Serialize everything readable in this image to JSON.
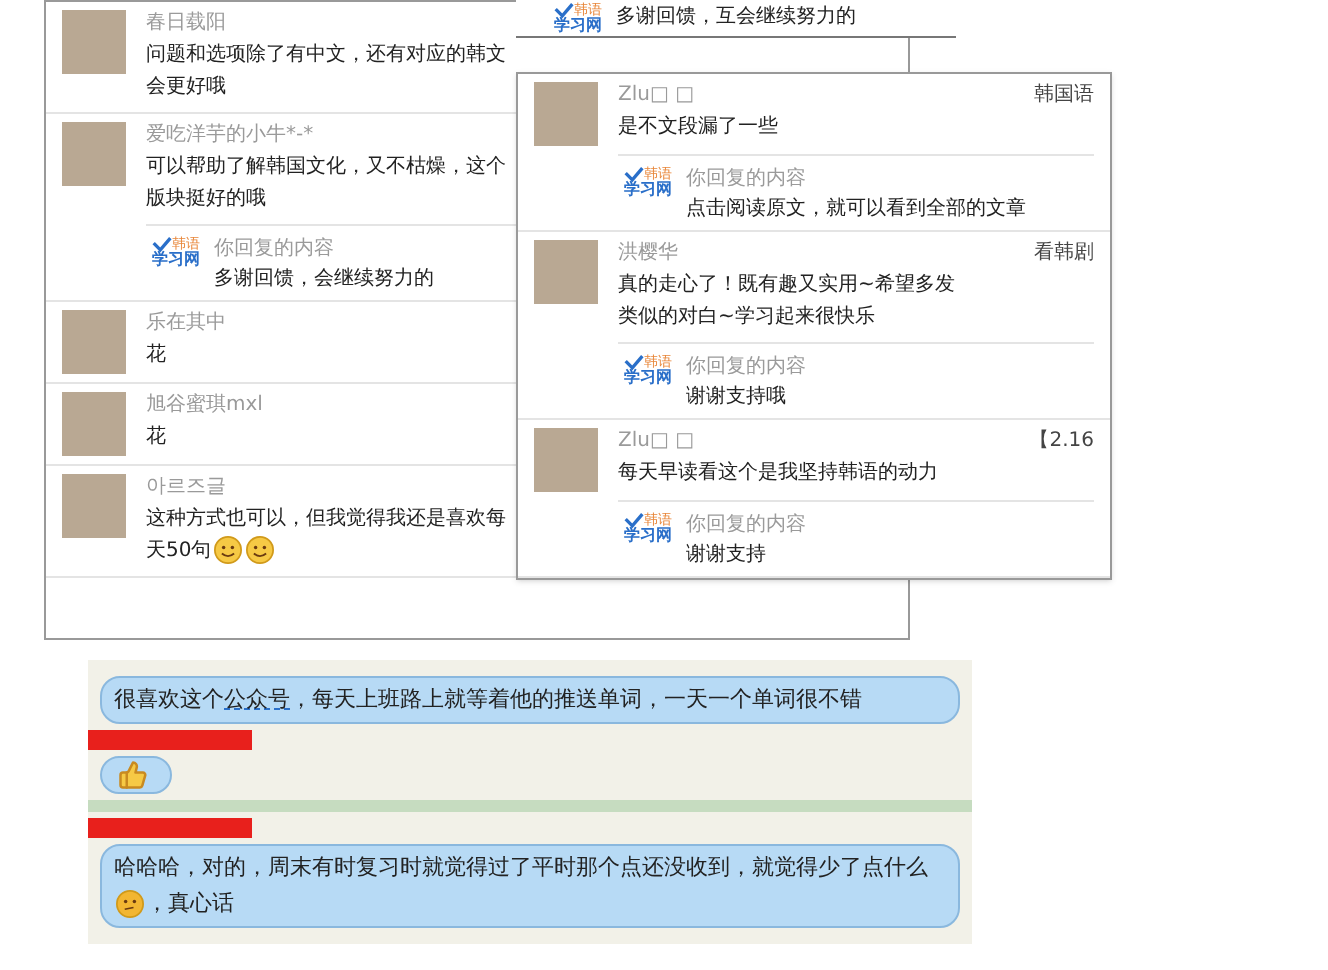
{
  "back_fragment": {
    "logo_top": "韩语",
    "logo_bottom": "学习网",
    "text": "多谢回馈，互会继续努力的"
  },
  "left_panel": {
    "comments": [
      {
        "author": "春日载阳",
        "text": "问题和选项除了有中文，还有对应的韩文会更好哦"
      },
      {
        "author": "爱吃洋芋的小牛*-*",
        "text": "可以帮助了解韩国文化，又不枯燥，这个版块挺好的哦",
        "reply": {
          "logo_top": "韩语",
          "logo_bottom": "学习网",
          "label": "你回复的内容",
          "text": "多谢回馈，会继续努力的"
        }
      },
      {
        "author": "乐在其中",
        "text": "花"
      },
      {
        "author": "旭谷蜜琪mxl",
        "text": "花"
      },
      {
        "author": "아르즈글",
        "text": "这种方式也可以，但我觉得我还是喜欢每天50句",
        "emojis": [
          {
            "kind": "smile"
          },
          {
            "kind": "smile"
          }
        ]
      }
    ]
  },
  "right_panel": {
    "comments": [
      {
        "author": "Zlu□ □",
        "tag": "韩国语",
        "text": "是不文段漏了一些",
        "reply": {
          "logo_top": "韩语",
          "logo_bottom": "学习网",
          "label": "你回复的内容",
          "text": "点击阅读原文，就可以看到全部的文章"
        }
      },
      {
        "author": "洪樱华",
        "tag": "看韩剧",
        "text": "真的走心了！既有趣又实用~希望多发类似的对白~学习起来很快乐",
        "reply": {
          "logo_top": "韩语",
          "logo_bottom": "学习网",
          "label": "你回复的内容",
          "text": "谢谢支持哦"
        }
      },
      {
        "author": "Zlu□ □",
        "tag": "【2.16",
        "text": "每天早读看这个是我坚持韩语的动力",
        "reply": {
          "logo_top": "韩语",
          "logo_bottom": "学习网",
          "label": "你回复的内容",
          "text": "谢谢支持"
        }
      }
    ]
  },
  "chat": {
    "messages": [
      {
        "kind": "text",
        "segments": [
          {
            "kind": "text",
            "text": "很喜欢这个"
          },
          {
            "kind": "underlined",
            "text": "公众号"
          },
          {
            "kind": "text",
            "text": "，每天上班路上就等着他的推送单词，一天一个单词很不错"
          }
        ]
      },
      {
        "kind": "redacted"
      },
      {
        "kind": "thumbs"
      },
      {
        "kind": "divider"
      },
      {
        "kind": "redacted"
      },
      {
        "kind": "text",
        "segments": [
          {
            "kind": "text",
            "text": "哈哈哈，对的，周末有时复习时就觉得过了平时那个点还没收到，就觉得少了点什么"
          },
          {
            "kind": "thinking"
          },
          {
            "kind": "text",
            "text": "，真心话"
          }
        ]
      }
    ]
  }
}
